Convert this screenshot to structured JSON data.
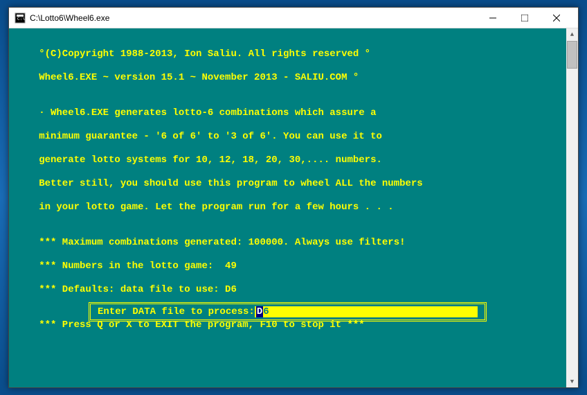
{
  "window": {
    "title": "C:\\Lotto6\\Wheel6.exe"
  },
  "console": {
    "line1": "   °(C)Copyright 1988-2013, Ion Saliu. All rights reserved °",
    "line2": "   Wheel6.EXE ~ version 15.1 ~ November 2013 - SALIU.COM °",
    "line3": "",
    "line4": "   · Wheel6.EXE generates lotto-6 combinations which assure a",
    "line5": "   minimum guarantee - '6 of 6' to '3 of 6'. You can use it to",
    "line6": "   generate lotto systems for 10, 12, 18, 20, 30,.... numbers.",
    "line7": "   Better still, you should use this program to wheel ALL the numbers",
    "line8": "   in your lotto game. Let the program run for a few hours . . .",
    "line9": "",
    "line10": "   *** Maximum combinations generated: 100000. Always use filters!",
    "line11": "   *** Numbers in the lotto game:  49",
    "line12": "   *** Defaults: data file to use: D6",
    "line13": "",
    "line14": "   *** Press Q or X to EXIT the program, F10 to stop it ***"
  },
  "input": {
    "prompt": " Enter DATA file to process: ",
    "cursor": "D",
    "rest": "6"
  }
}
